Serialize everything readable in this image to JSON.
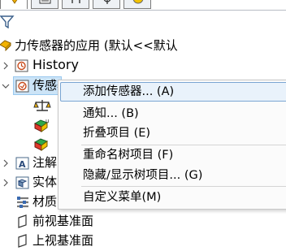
{
  "tree": {
    "root_label": "力传感器的应用 (默认<<默认",
    "items": [
      {
        "label": "History"
      },
      {
        "label": "传感器"
      },
      {
        "label": "注解"
      },
      {
        "label": "实体"
      },
      {
        "label": "材质"
      },
      {
        "label": "前视基准面"
      },
      {
        "label": "上视基准面"
      }
    ]
  },
  "context_menu": {
    "items": [
      {
        "label": "添加传感器... (A)"
      },
      {
        "label": "通知... (B)"
      },
      {
        "label": "折叠项目 (E)"
      },
      {
        "label": "重命名树项目 (F)"
      },
      {
        "label": "隐藏/显示树项目... (G)"
      },
      {
        "label": "自定义菜单(M)"
      }
    ]
  },
  "colors": {
    "accent": "#f2b200",
    "menu_highlight": "#e9f2fb",
    "menu_highlight_border": "#7aa5d3",
    "selection": "#cce4f7"
  }
}
